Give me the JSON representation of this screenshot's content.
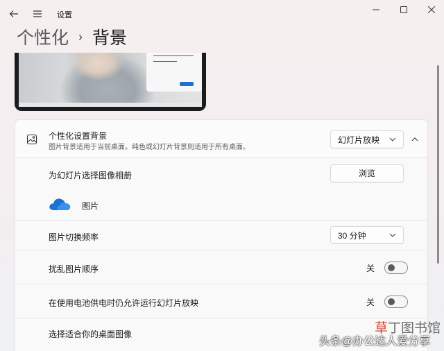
{
  "window": {
    "title": "设置",
    "minimize_icon": "minimize-icon",
    "maximize_icon": "maximize-icon",
    "close_icon": "close-icon"
  },
  "nav": {
    "back_icon": "back-arrow-icon",
    "menu_icon": "hamburger-menu-icon"
  },
  "breadcrumb": {
    "parent": "个性化",
    "separator": "›",
    "current": "背景"
  },
  "background": {
    "title": "个性化设置背景",
    "description": "图片背景适用于当前桌面。纯色或幻灯片背景则适用于所有桌面。",
    "type_value": "幻灯片放映",
    "icon": "picture-icon"
  },
  "album": {
    "label": "为幻灯片选择图像相册",
    "browse_label": "浏览",
    "folder_name": "图片",
    "folder_icon": "onedrive-cloud-icon"
  },
  "interval": {
    "label": "图片切换频率",
    "value": "30 分钟"
  },
  "shuffle": {
    "label": "扰乱图片顺序",
    "state": "关"
  },
  "battery": {
    "label": "在使用电池供电时仍允许运行幻灯片放映",
    "state": "关"
  },
  "fit": {
    "label": "选择适合你的桌面图像"
  },
  "watermark": {
    "site_part1": "草",
    "site_part2": "丁图书馆",
    "author": "头条@办公达人爱分享"
  },
  "colors": {
    "accent": "#1f6fd1",
    "watermark_red": "#d5442f"
  }
}
